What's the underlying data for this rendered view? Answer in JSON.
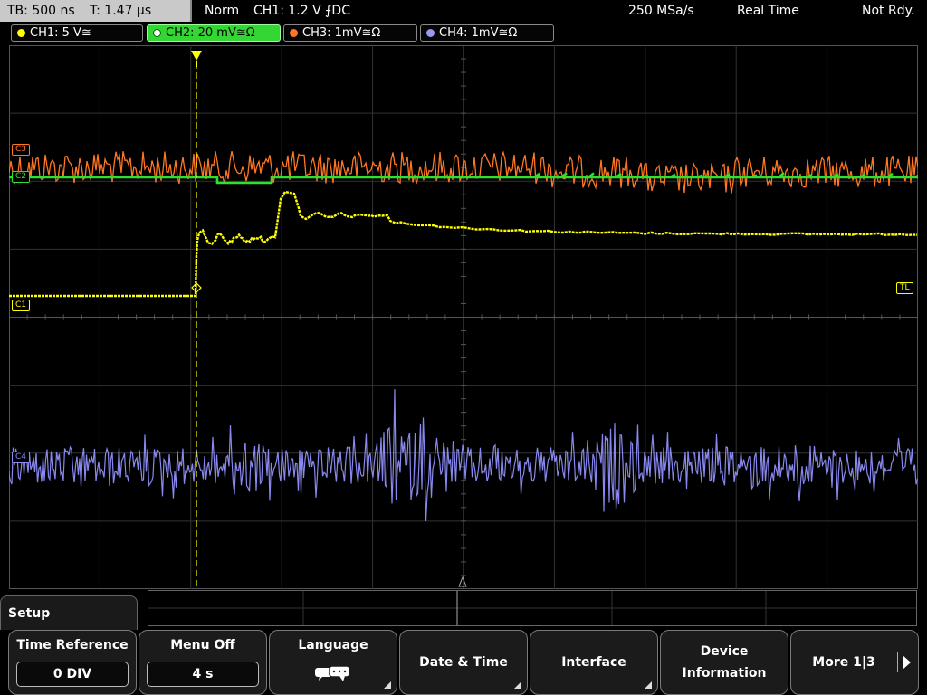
{
  "topbar": {
    "timebase": "TB: 500 ns",
    "trigger_time": "T: 1.47 µs",
    "mode": "Norm",
    "trigger_info": "CH1: 1.2 V ⨍DC",
    "sample_rate": "250 MSa/s",
    "acq_mode": "Real Time",
    "status": "Not Rdy."
  },
  "channels": [
    {
      "label": "CH1: 5 V≅",
      "color": "#ffff00",
      "active": false
    },
    {
      "label": "CH2: 20 mV≅Ω",
      "color": "#33cc33",
      "active": true
    },
    {
      "label": "CH3: 1mV≅Ω",
      "color": "#ff7722",
      "active": false
    },
    {
      "label": "CH4: 1mV≅Ω",
      "color": "#9999ee",
      "active": false
    }
  ],
  "markers": {
    "c3": "C3",
    "c2": "C2",
    "c1": "C1",
    "c4": "C4",
    "trigger_level": "TL"
  },
  "menu": {
    "title": "Setup",
    "softkeys": [
      {
        "label": "Time Reference",
        "value": "0 DIV"
      },
      {
        "label": "Menu Off",
        "value": "4 s"
      },
      {
        "label": "Language",
        "icon": "speech-bubbles-icon"
      },
      {
        "label": "Date & Time"
      },
      {
        "label": "Interface"
      },
      {
        "label": "Device Information"
      },
      {
        "label": "More 1|3"
      }
    ]
  },
  "colors": {
    "ch1": "#ffff00",
    "ch2": "#2ee02e",
    "ch3": "#ff7722",
    "ch4": "#8888ee",
    "grid": "#3a3a3a"
  }
}
